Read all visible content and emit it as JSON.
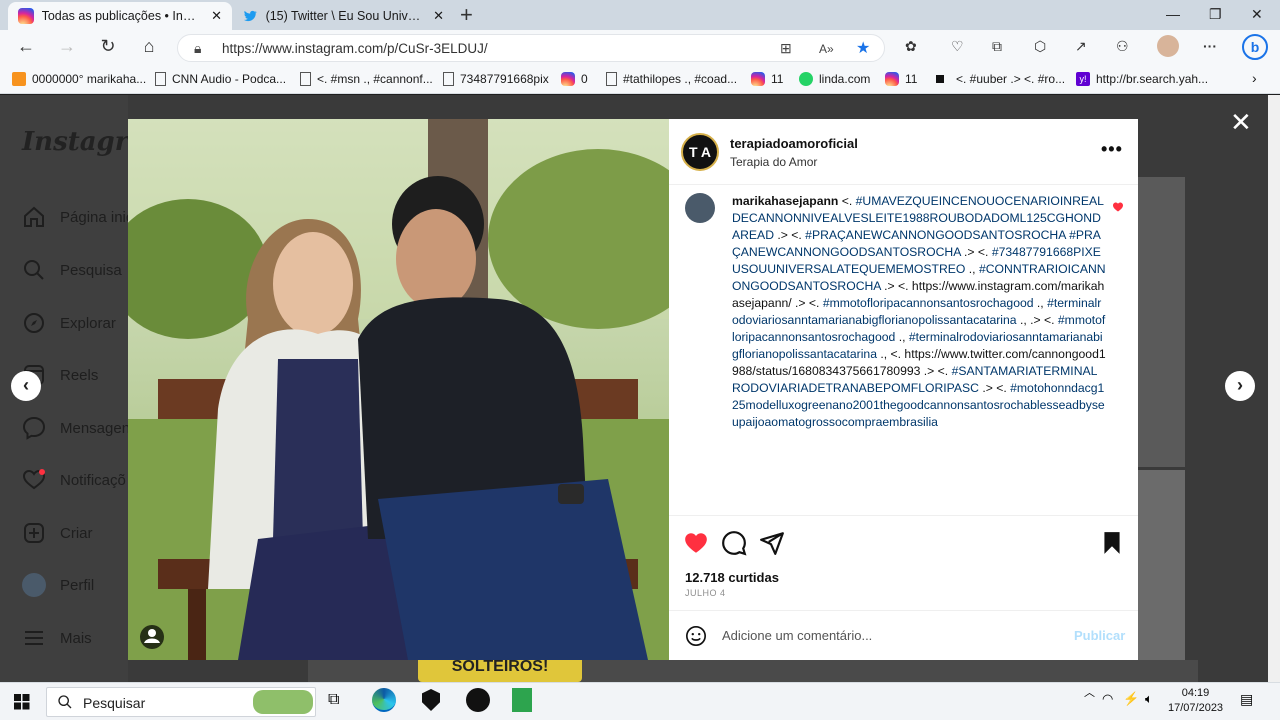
{
  "browser": {
    "tabs": [
      {
        "label": "Todas as publicações • Instagram",
        "active": true
      },
      {
        "label": "(15) Twitter \\ Eu Sou Universal (E",
        "active": false
      }
    ],
    "url": "https://www.instagram.com/p/CuSr-3ELDUJ/",
    "bookmarks": [
      {
        "label": "0000000° marikaha...",
        "icon": "ok-icon"
      },
      {
        "label": "CNN Audio - Podca...",
        "icon": "page-icon"
      },
      {
        "label": "<. #msn ., #cannonf...",
        "icon": "page-icon"
      },
      {
        "label": "73487791668pix",
        "icon": "page-icon"
      },
      {
        "label": "0",
        "icon": "instagram-icon"
      },
      {
        "label": "#tathilopes ., #coad...",
        "icon": "page-icon"
      },
      {
        "label": "11",
        "icon": "instagram-icon"
      },
      {
        "label": "linda.com",
        "icon": "whatsapp-icon"
      },
      {
        "label": "11",
        "icon": "instagram-icon"
      },
      {
        "label": "<. #uuber .> <. #ro...",
        "icon": "square-icon"
      },
      {
        "label": "http://br.search.yah...",
        "icon": "yahoo-icon"
      }
    ]
  },
  "sidebar": {
    "logo": "Instagram",
    "items": [
      {
        "label": "Página inic",
        "icon": "home-icon"
      },
      {
        "label": "Pesquisa",
        "icon": "search-icon"
      },
      {
        "label": "Explorar",
        "icon": "compass-icon"
      },
      {
        "label": "Reels",
        "icon": "reels-icon"
      },
      {
        "label": "Mensagen",
        "icon": "messenger-icon"
      },
      {
        "label": "Notificaçõ",
        "icon": "heart-icon"
      },
      {
        "label": "Criar",
        "icon": "plus-icon"
      },
      {
        "label": "Perfil",
        "icon": "avatar-icon"
      },
      {
        "label": "Mais",
        "icon": "menu-icon"
      }
    ]
  },
  "background": {
    "banner_text": "SOLTEIROS!"
  },
  "post": {
    "account": "terapiadoamoroficial",
    "account_subtitle": "Terapia do Amor",
    "avatar_text": "T A",
    "comment_user": "marikahasejapann",
    "comment_parts": [
      {
        "t": " <. ",
        "tag": false
      },
      {
        "t": "#UMAVEZQUEINCENOUOCENARIOINREALDECANNONNIVEALVESLEITE1988ROUBODADOML125CGHONDAREAD",
        "tag": true
      },
      {
        "t": " .> <. ",
        "tag": false
      },
      {
        "t": "#PRAÇANEWCANNONGOODSANTOSROCHA",
        "tag": true
      },
      {
        "t": " ",
        "tag": false
      },
      {
        "t": "#PRAÇANEWCANNONGOODSANTOSROCHA",
        "tag": true
      },
      {
        "t": " .> <. ",
        "tag": false
      },
      {
        "t": "#73487791668PIXEUSOUUNIVERSALATEQUEMEMOSTREO",
        "tag": true
      },
      {
        "t": " ., ",
        "tag": false
      },
      {
        "t": "#CONNTRARIOICANNONGOODSANTOSROCHA",
        "tag": true
      },
      {
        "t": " .> <. https://www.instagram.com/marikahasejapann/ .> <. ",
        "tag": false
      },
      {
        "t": "#mmotofloripacannonsantosrochagood",
        "tag": true
      },
      {
        "t": " ., ",
        "tag": false
      },
      {
        "t": "#terminalrodoviariosanntamarianabigflorianopolissantacatarina",
        "tag": true
      },
      {
        "t": " ., .> <. ",
        "tag": false
      },
      {
        "t": "#mmotofloripacannonsantosrochagood",
        "tag": true
      },
      {
        "t": " ., ",
        "tag": false
      },
      {
        "t": "#terminalrodoviariosanntamarianabigflorianopolissantacatarina",
        "tag": true
      },
      {
        "t": " ., <. https://www.twitter.com/cannongood1988/status/1680834375661780993 .> <. ",
        "tag": false
      },
      {
        "t": "#SANTAMARIATERMINALRODOVIARIADETRANABEPOMFLORIPASC",
        "tag": true
      },
      {
        "t": " .> <. ",
        "tag": false
      },
      {
        "t": "#motohonndacg125modelluxogreenano2001thegoodcannonsantosrochablesseadbyseupaijoaomatogrossocompraembrasilia",
        "tag": true
      }
    ],
    "likes": "12.718 curtidas",
    "date": "JULHO 4",
    "comment_placeholder": "Adicione um comentário...",
    "publish": "Publicar",
    "liked": true,
    "saved": true
  },
  "taskbar": {
    "search": "Pesquisar",
    "time": "04:19",
    "date": "17/07/2023"
  },
  "colors": {
    "accent": "#0095f6",
    "like": "#ff3040",
    "tag": "#00376b"
  }
}
